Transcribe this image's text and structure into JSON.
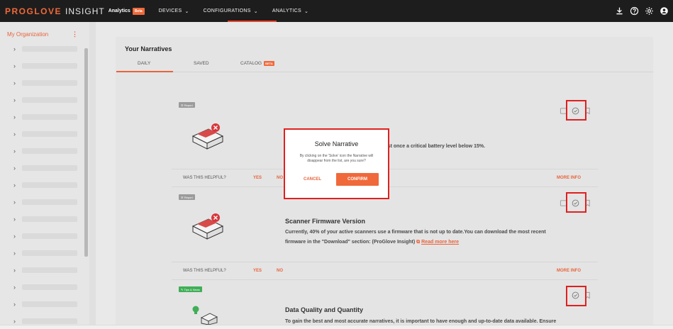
{
  "topbar": {
    "brand_pro": "PROGLOVE",
    "brand_insight": "INSIGHT",
    "brand_analytics": "Analytics",
    "beta_badge": "Beta",
    "nav": [
      {
        "label": "DEVICES",
        "chevron": "⌄"
      },
      {
        "label": "CONFIGURATIONS",
        "chevron": "⌄"
      },
      {
        "label": "ANALYTICS",
        "chevron": "⌄"
      }
    ],
    "icons": [
      "download-icon",
      "help-icon",
      "settings-icon",
      "account-icon"
    ],
    "accent": "#f0693a"
  },
  "sidebar": {
    "org_title": "My Organization",
    "more": "⋮",
    "item_count": 17
  },
  "main": {
    "title": "Your Narratives",
    "tabs": [
      {
        "label": "DAILY",
        "active": true
      },
      {
        "label": "SAVED",
        "active": false
      },
      {
        "label": "CATALOG",
        "badge": "BETA",
        "active": false
      }
    ]
  },
  "cards": [
    {
      "tag": "☰ Report",
      "title": "",
      "desc": "reached at least once a critical battery level below 15%.",
      "feedback": {
        "question": "WAS THIS HELPFUL?",
        "yes": "YES",
        "no": "NO",
        "more": "MORE INFO"
      }
    },
    {
      "tag": "☰ Report",
      "title": "Scanner Firmware Version",
      "desc_1": "Currently, 40% of your active scanners use a firmware that is not up to date.You can download the most recent",
      "desc_2": "firmware in the \"Download\" section: (ProGlove Insight)",
      "link": "Read more here",
      "feedback": {
        "question": "WAS THIS HELPFUL?",
        "yes": "YES",
        "no": "NO",
        "more": "MORE INFO"
      }
    },
    {
      "tag": "Tips & News",
      "title": "Data Quality and Quantity",
      "desc": "To gain the best and most accurate narratives, it is important to have enough and up-to-date data available. Ensure"
    }
  ],
  "modal": {
    "title": "Solve Narrative",
    "text": "By clicking on the 'Solve' icon the Narrative will disappear from the list, are you sure?",
    "cancel": "CANCEL",
    "confirm": "CONFIRM"
  }
}
